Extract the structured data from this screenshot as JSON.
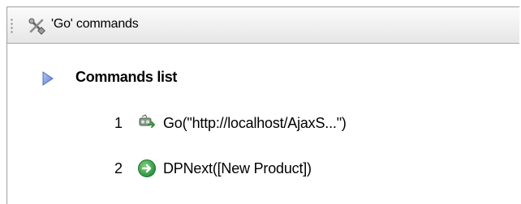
{
  "panel": {
    "title": "'Go' commands",
    "title_icon": "tools-icon"
  },
  "section": {
    "title": "Commands list",
    "icon": "triangle-right-icon"
  },
  "commands": [
    {
      "number": "1",
      "icon": "go-url-icon",
      "text": "Go(\"http://localhost/AjaxS...\")"
    },
    {
      "number": "2",
      "icon": "next-arrow-icon",
      "text": "DPNext([New Product])"
    }
  ],
  "colors": {
    "section_triangle": "#6f8fd8",
    "next_icon": "#2fa84f",
    "header_border": "#a9a9a9"
  }
}
